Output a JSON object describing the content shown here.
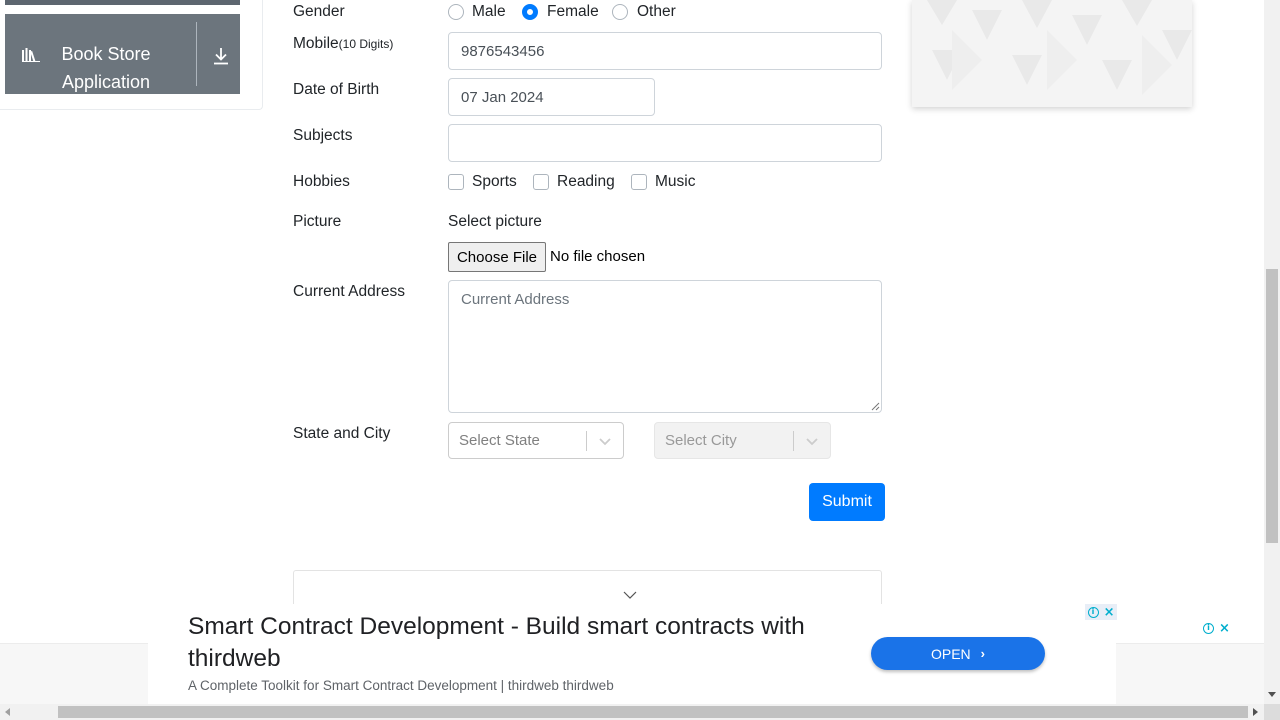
{
  "sidebar": {
    "app_label": "Book Store Application",
    "app_icon": "books-icon",
    "download_icon": "download-icon"
  },
  "form": {
    "gender": {
      "label": "Gender",
      "options": [
        "Male",
        "Female",
        "Other"
      ],
      "selected": "Female"
    },
    "mobile": {
      "label": "Mobile",
      "hint": "(10 Digits)",
      "value": "9876543456"
    },
    "dob": {
      "label": "Date of Birth",
      "value": "07 Jan 2024"
    },
    "subjects": {
      "label": "Subjects",
      "value": ""
    },
    "hobbies": {
      "label": "Hobbies",
      "options": [
        "Sports",
        "Reading",
        "Music"
      ],
      "checked": []
    },
    "picture": {
      "label": "Picture",
      "select_text": "Select picture",
      "button": "Choose File",
      "status": "No file chosen"
    },
    "address": {
      "label": "Current Address",
      "placeholder": "Current Address"
    },
    "state_city": {
      "label": "State and City",
      "state_placeholder": "Select State",
      "city_placeholder": "Select City"
    },
    "submit": "Submit"
  },
  "ad": {
    "title": "Smart Contract Development - Build smart contracts with thirdweb",
    "subtitle": "A Complete Toolkit for Smart Contract Development | thirdweb thirdweb",
    "cta": "OPEN",
    "colors": {
      "cta": "#1a73e8",
      "adchoices": "#00aecd"
    }
  },
  "colors": {
    "primary": "#007bff",
    "sidebar": "#6c757d"
  }
}
